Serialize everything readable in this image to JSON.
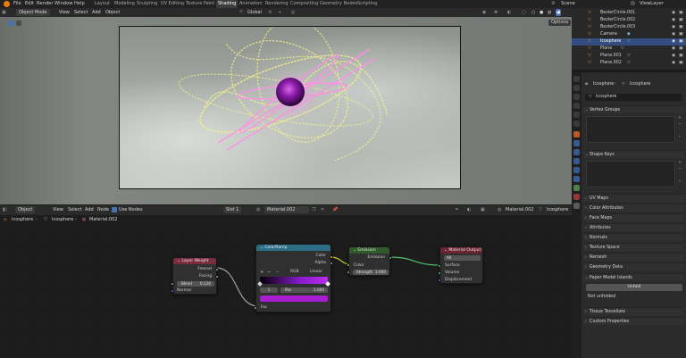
{
  "menu": {
    "items": [
      "File",
      "Edit",
      "Render",
      "Window",
      "Help"
    ],
    "workspaces": [
      "Layout",
      "Modeling",
      "Sculpting",
      "UV Editing",
      "Texture Paint",
      "Shading",
      "Animation",
      "Rendering",
      "Compositing",
      "Geometry Nodes",
      "Scripting"
    ],
    "active_workspace": "Shading",
    "scene": "Scene",
    "view_layer": "ViewLayer"
  },
  "viewport_header": {
    "mode": "Object Mode",
    "view": "View",
    "select": "Select",
    "add": "Add",
    "object": "Object",
    "orientation": "Global",
    "options": "Options"
  },
  "node_header": {
    "editor_type": "Object",
    "view": "View",
    "select": "Select",
    "add": "Add",
    "node": "Node",
    "use_nodes": "Use Nodes",
    "slot": "Slot 1",
    "material": "Material.002",
    "material_right": "Material.002",
    "object_right": "Icosphere"
  },
  "breadcrumb": [
    "Icosphere",
    "Icosphere",
    "Material.002"
  ],
  "nodes": {
    "layer_weight": {
      "title": "Layer Weight",
      "outputs": [
        "Fresnel",
        "Facing"
      ],
      "blend_label": "Blend",
      "blend_value": "0.120",
      "normal": "Normal"
    },
    "color_ramp": {
      "title": "ColorRamp",
      "outputs": [
        "Color",
        "Alpha"
      ],
      "mode": "RGB",
      "interp": "Linear",
      "index": "1",
      "pos_label": "Pos",
      "pos_value": "1.000",
      "fac": "Fac"
    },
    "emission": {
      "title": "Emission",
      "output": "Emission",
      "color": "Color",
      "strength_label": "Strength",
      "strength_value": "3.000"
    },
    "material_output": {
      "title": "Material Output",
      "target": "All",
      "inputs": [
        "Surface",
        "Volume",
        "Displacement"
      ]
    }
  },
  "outliner": {
    "rows": [
      "BezierCircle.001",
      "BezierCircle.002",
      "BezierCircle.003",
      "Camera",
      "Icosphere",
      "Plane",
      "Plane.001",
      "Plane.002"
    ],
    "selected_index": 4
  },
  "properties": {
    "object_name": "Icosphere",
    "mesh_name": "Icosphere",
    "data_field": "Icosphere",
    "panels_top": [
      "Vertex Groups",
      "Shape Keys"
    ],
    "panels_mid": [
      "UV Maps",
      "Color Attributes",
      "Face Maps",
      "Attributes",
      "Normals",
      "Texture Space",
      "Remesh",
      "Geometry Data"
    ],
    "paper_model": "Paper Model Islands",
    "unfold_button": "Unfold",
    "not_unfolded": "Not unfolded",
    "panels_bottom": [
      "Tissue Tessellate",
      "Custom Properties"
    ]
  },
  "colors": {
    "accent_blue": "#334d80",
    "layer_weight_header": "#7a2b3c",
    "color_ramp_header": "#2d6e87",
    "emission_header": "#2f5a2a",
    "output_header": "#6b2430",
    "socket_yellow": "#c7c729",
    "socket_grey": "#a1a1a1",
    "socket_green": "#4fc26b",
    "socket_purple": "#6363c7"
  }
}
